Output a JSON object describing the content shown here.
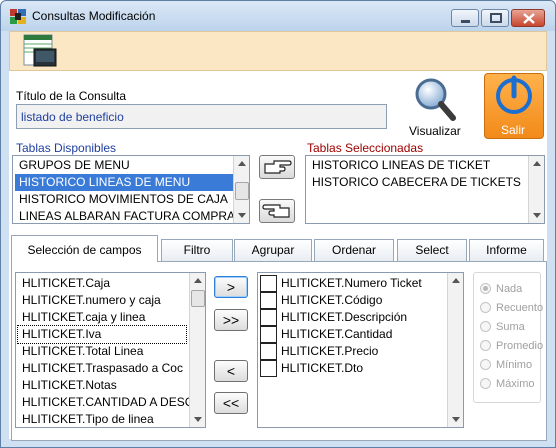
{
  "window": {
    "title": "Consultas Modificación"
  },
  "toolbar": {
    "icon": "table-design-icon"
  },
  "query": {
    "title_label": "Título de la Consulta",
    "title_value": "listado de beneficio",
    "visualize_label": "Visualizar",
    "exit_label": "Salir"
  },
  "tables": {
    "available_label": "Tablas Disponibles",
    "selected_label": "Tablas Seleccionadas",
    "available": [
      "GRUPOS DE MENU",
      "HISTORICO LINEAS DE MENU",
      "HISTORICO MOVIMIENTOS DE CAJA",
      "LINEAS ALBARAN FACTURA COMPRAS"
    ],
    "available_selected_index": 1,
    "selected": [
      "HISTORICO LINEAS DE TICKET",
      "HISTORICO CABECERA DE TICKETS"
    ]
  },
  "tabs": [
    "Selección de campos",
    "Filtro",
    "Agrupar",
    "Ordenar",
    "Select",
    "Informe"
  ],
  "fields": {
    "available": [
      "HLITICKET.Caja",
      "HLITICKET.numero y caja",
      "HLITICKET.caja y linea",
      "HLITICKET.Iva",
      "HLITICKET.Total Linea",
      "HLITICKET.Traspasado a Coc",
      "HLITICKET.Notas",
      "HLITICKET.CANTIDAD A DESC",
      "HLITICKET.Tipo de linea"
    ],
    "available_focused_index": 3,
    "selected": [
      "HLITICKET.Numero Ticket",
      "HLITICKET.Código",
      "HLITICKET.Descripción",
      "HLITICKET.Cantidad",
      "HLITICKET.Precio",
      "HLITICKET.Dto"
    ]
  },
  "buttons": {
    "add_one": ">",
    "add_all": ">>",
    "remove_one": "<",
    "remove_all": "<<"
  },
  "aggregates": {
    "options": [
      "Nada",
      "Recuento",
      "Suma",
      "Promedio",
      "Mínimo",
      "Máximo"
    ],
    "selected_index": 0,
    "enabled": false
  },
  "colors": {
    "accent": "#3a7bd8",
    "exit_button": "#f28a1a",
    "toolbar_background": "#fbe7c3"
  }
}
